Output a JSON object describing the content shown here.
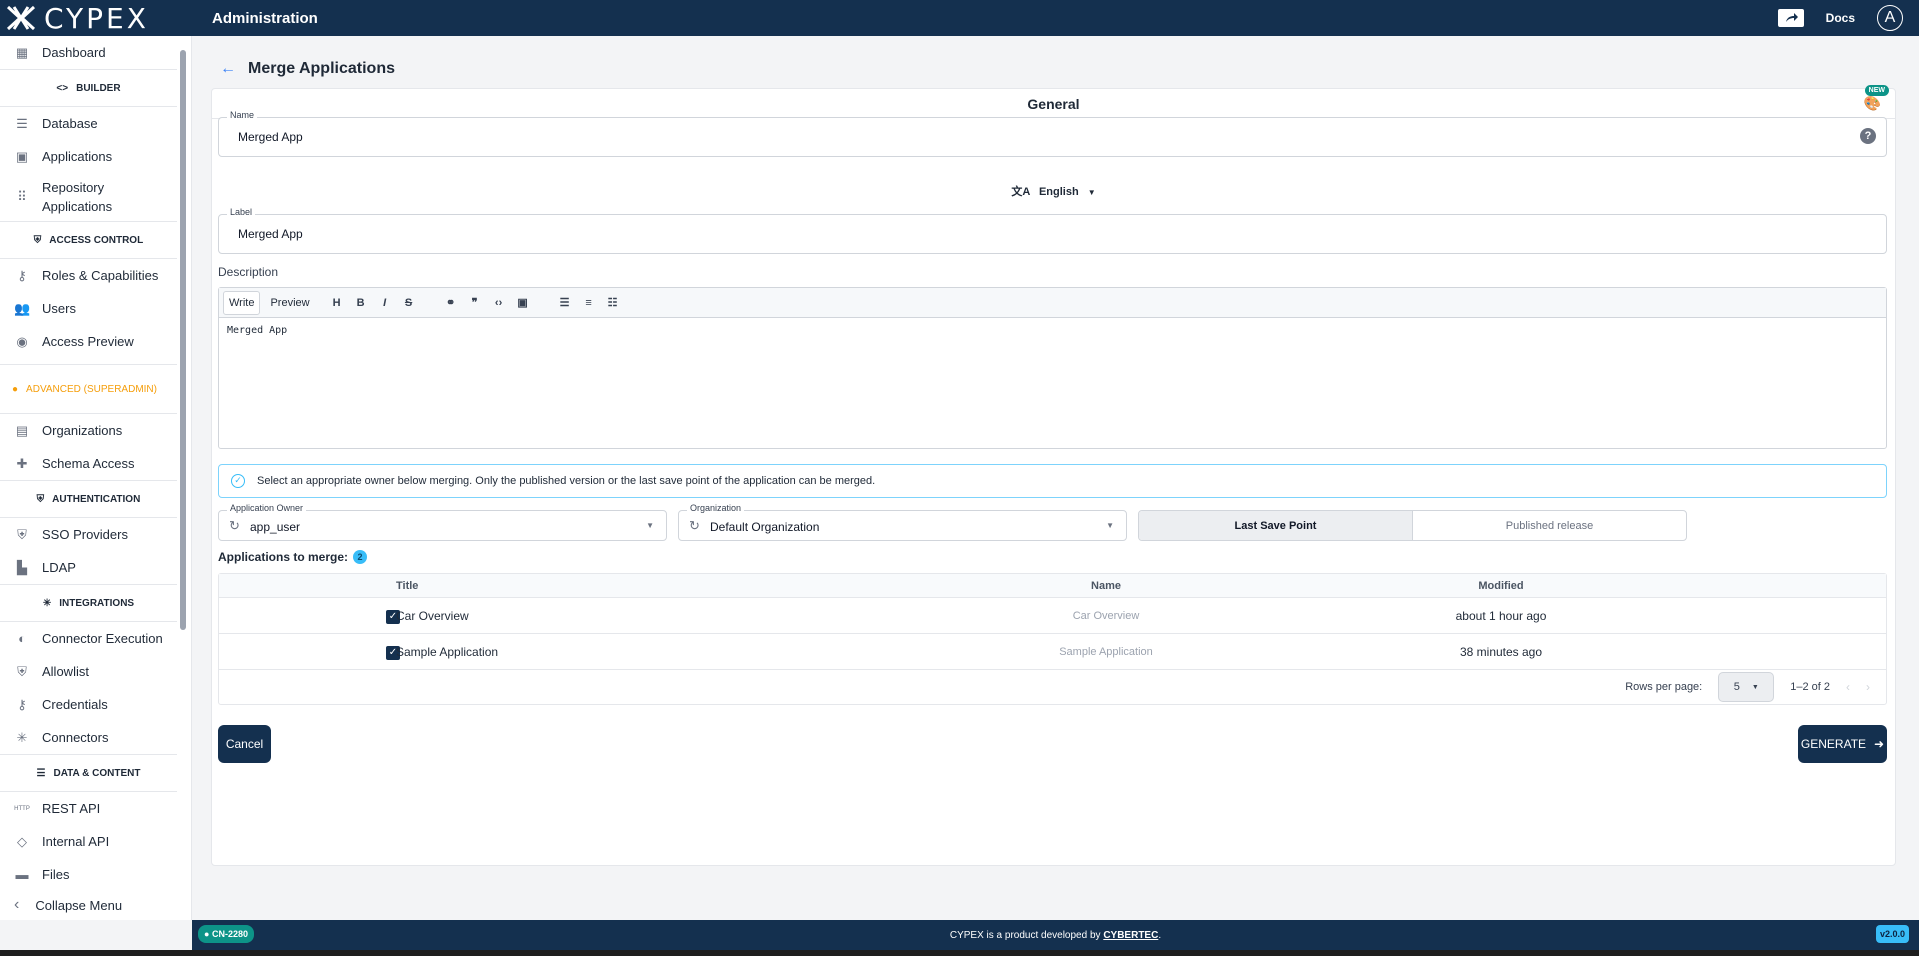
{
  "app": {
    "logo_text": "CYPEX",
    "title": "Administration",
    "docs_label": "Docs",
    "avatar_initial": "A"
  },
  "sidebar": {
    "items_top": [
      {
        "label": "Dashboard",
        "icon": "dashboard-icon"
      }
    ],
    "builder_label": "BUILDER",
    "builder_items": [
      {
        "label": "Database",
        "icon": "list-icon"
      },
      {
        "label": "Applications",
        "icon": "app-icon"
      },
      {
        "label": "Repository Applications",
        "icon": "grid-icon"
      }
    ],
    "access_label": "ACCESS CONTROL",
    "access_items": [
      {
        "label": "Roles & Capabilities",
        "icon": "key-icon"
      },
      {
        "label": "Users",
        "icon": "users-icon"
      },
      {
        "label": "Access Preview",
        "icon": "eye-icon"
      }
    ],
    "advanced_label": "ADVANCED (SUPERADMIN)",
    "advanced_items": [
      {
        "label": "Organizations",
        "icon": "building-icon"
      },
      {
        "label": "Schema Access",
        "icon": "puzzle-icon"
      }
    ],
    "auth_label": "AUTHENTICATION",
    "auth_items": [
      {
        "label": "SSO Providers",
        "icon": "shield-icon"
      },
      {
        "label": "LDAP",
        "icon": "ldap-icon"
      }
    ],
    "integrations_label": "INTEGRATIONS",
    "integration_items": [
      {
        "label": "Connector Execution",
        "icon": "toggle-icon"
      },
      {
        "label": "Allowlist",
        "icon": "shield-icon"
      },
      {
        "label": "Credentials",
        "icon": "key-icon"
      },
      {
        "label": "Connectors",
        "icon": "hub-icon"
      }
    ],
    "data_label": "DATA & CONTENT",
    "data_items": [
      {
        "label": "REST API",
        "icon": "http-icon"
      },
      {
        "label": "Internal API",
        "icon": "api-icon"
      },
      {
        "label": "Files",
        "icon": "folder-icon"
      }
    ],
    "collapse_label": "Collapse Menu"
  },
  "page": {
    "title": "Merge Applications",
    "section_title": "General",
    "new_badge": "NEW",
    "name_label": "Name",
    "name_value": "Merged App",
    "language": "English",
    "label_label": "Label",
    "label_value": "Merged App",
    "description_label": "Description",
    "editor": {
      "write_tab": "Write",
      "preview_tab": "Preview",
      "content": "Merged App"
    },
    "info_text": "Select an appropriate owner below merging. Only the published version or the last save point of the application can be merged.",
    "owner_label": "Application Owner",
    "owner_value": "app_user",
    "org_label": "Organization",
    "org_value": "Default Organization",
    "toggle_active": "Last Save Point",
    "toggle_inactive": "Published release",
    "apps_title": "Applications to merge:",
    "apps_count": "2",
    "table": {
      "headers": [
        "Title",
        "Name",
        "Modified"
      ],
      "rows": [
        {
          "title": "Car Overview",
          "name": "Car Overview",
          "modified": "about 1 hour ago"
        },
        {
          "title": "Sample Application",
          "name": "Sample Application",
          "modified": "38 minutes ago"
        }
      ],
      "rows_per_page_label": "Rows per page:",
      "rows_per_page": "5",
      "range": "1–2 of 2"
    },
    "cancel_label": "Cancel",
    "generate_label": "GENERATE"
  },
  "footer": {
    "left_badge": "CN-2280",
    "text_prefix": "CYPEX is a product developed by ",
    "text_link": "CYBERTEC",
    "text_suffix": ".",
    "version": "v2.0.0"
  }
}
